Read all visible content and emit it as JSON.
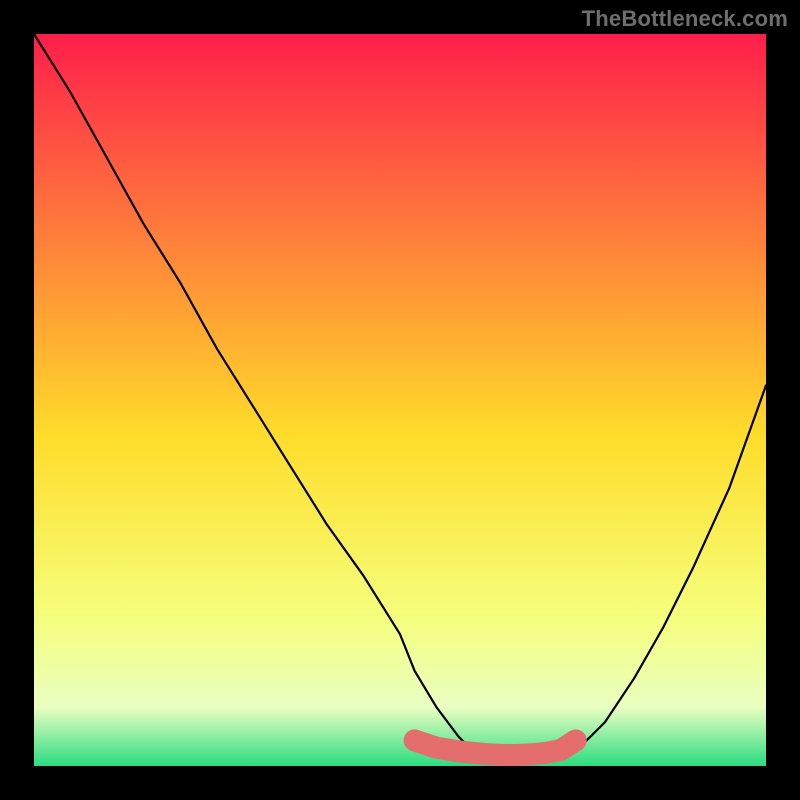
{
  "attribution": "TheBottleneck.com",
  "chart_data": {
    "type": "line",
    "title": "",
    "xlabel": "",
    "ylabel": "",
    "xlim": [
      0,
      100
    ],
    "ylim": [
      0,
      100
    ],
    "legend": false,
    "grid": false,
    "background_gradient": {
      "top": "#ff1e4b",
      "mid1": "#ffdd2a",
      "mid2": "#f5ff7e",
      "band": "#e9ffc1",
      "bottom": "#2bdc82"
    },
    "series": [
      {
        "name": "bottleneck-curve",
        "color": "#000000",
        "x": [
          0,
          5,
          10,
          15,
          20,
          25,
          30,
          35,
          40,
          45,
          50,
          52,
          55,
          58,
          60,
          62,
          64,
          66,
          70,
          72,
          75,
          78,
          82,
          86,
          90,
          95,
          100
        ],
        "y": [
          100,
          92,
          83,
          74,
          66,
          57,
          49,
          41,
          33,
          26,
          18,
          13,
          8,
          4,
          2,
          1,
          0.5,
          0.5,
          0.5,
          1,
          3,
          6,
          12,
          19,
          27,
          38,
          52
        ]
      },
      {
        "name": "bottom-highlight-sausage",
        "color": "#e46e6e",
        "x": [
          52,
          55,
          58,
          60,
          62,
          64,
          66,
          68,
          70,
          72,
          74
        ],
        "y": [
          3.5,
          2.5,
          2,
          1.8,
          1.6,
          1.5,
          1.5,
          1.6,
          1.8,
          2.2,
          3.5
        ]
      }
    ]
  }
}
